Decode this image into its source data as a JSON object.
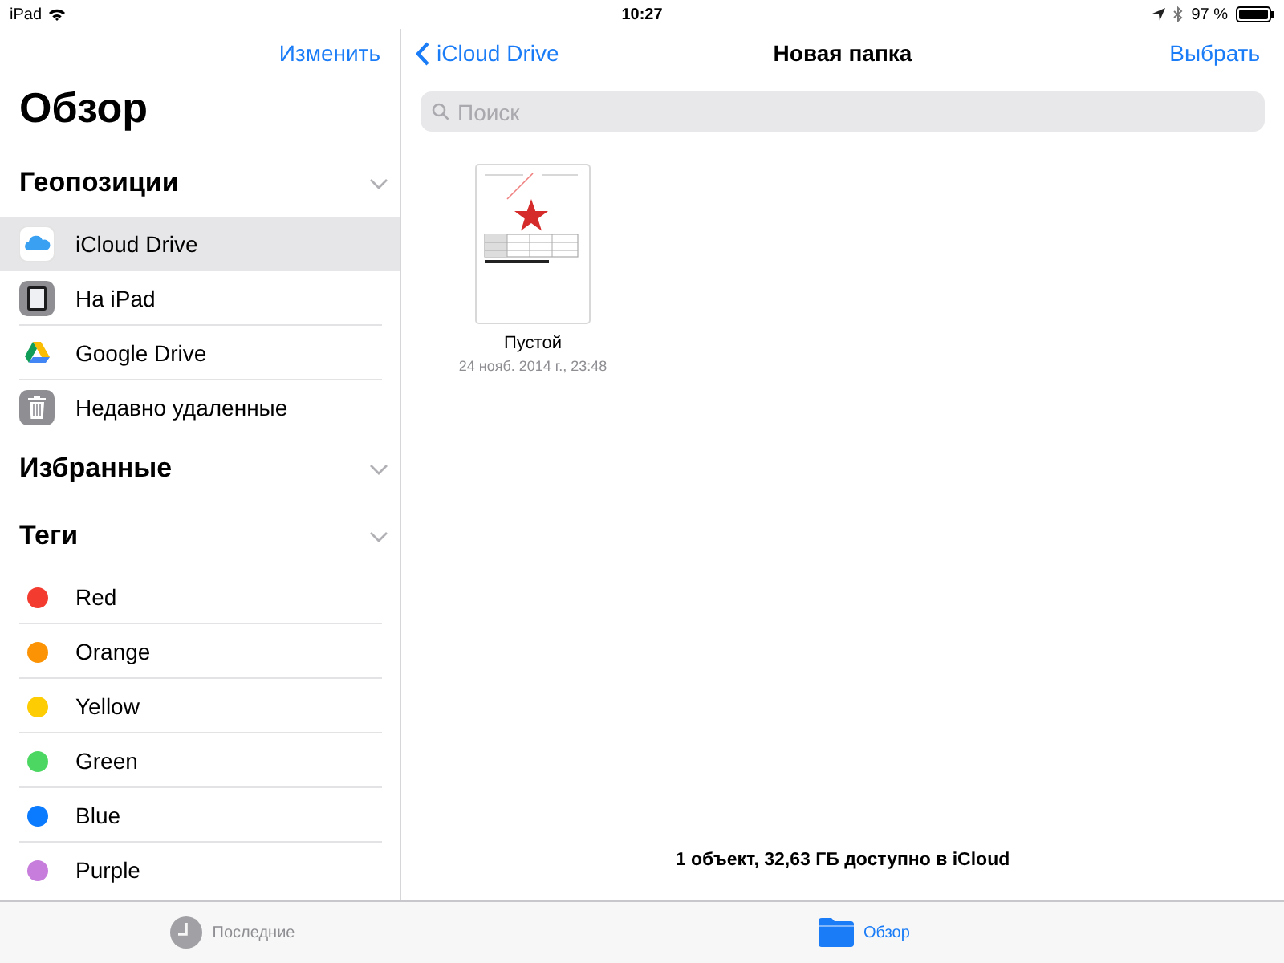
{
  "status_bar": {
    "device": "iPad",
    "time": "10:27",
    "battery": "97 %"
  },
  "sidebar": {
    "edit_button": "Изменить",
    "title": "Обзор",
    "sections": [
      {
        "title": "Геопозиции",
        "items": [
          {
            "kind": "icloud",
            "label": "iCloud Drive",
            "selected": true
          },
          {
            "kind": "ipad",
            "label": "На iPad",
            "selected": false
          },
          {
            "kind": "gdrive",
            "label": "Google Drive",
            "selected": false
          },
          {
            "kind": "trash",
            "label": "Недавно удаленные",
            "selected": false
          }
        ]
      },
      {
        "title": "Избранные"
      },
      {
        "title": "Теги",
        "items": [
          {
            "kind": "tag",
            "label": "Red",
            "color": "#f33b30",
            "selected": false
          },
          {
            "kind": "tag",
            "label": "Orange",
            "color": "#fb9304",
            "selected": false
          },
          {
            "kind": "tag",
            "label": "Yellow",
            "color": "#fdcc02",
            "selected": false
          },
          {
            "kind": "tag",
            "label": "Green",
            "color": "#4bd762",
            "selected": false
          },
          {
            "kind": "tag",
            "label": "Blue",
            "color": "#0a7afe",
            "selected": false
          },
          {
            "kind": "tag",
            "label": "Purple",
            "color": "#c77ddb",
            "selected": false
          }
        ]
      }
    ]
  },
  "main": {
    "back_button": "iCloud Drive",
    "title": "Новая папка",
    "select_button": "Выбрать",
    "search": {
      "placeholder": "Поиск"
    },
    "files": [
      {
        "name": "Пустой",
        "date": "24 нояб. 2014 г., 23:48"
      }
    ],
    "footer": "1 объект, 32,63 ГБ доступно в iCloud"
  },
  "tab_bar": [
    {
      "kind": "recent",
      "label": "Последние",
      "selected": false
    },
    {
      "kind": "browse",
      "label": "Обзор",
      "selected": true
    }
  ]
}
